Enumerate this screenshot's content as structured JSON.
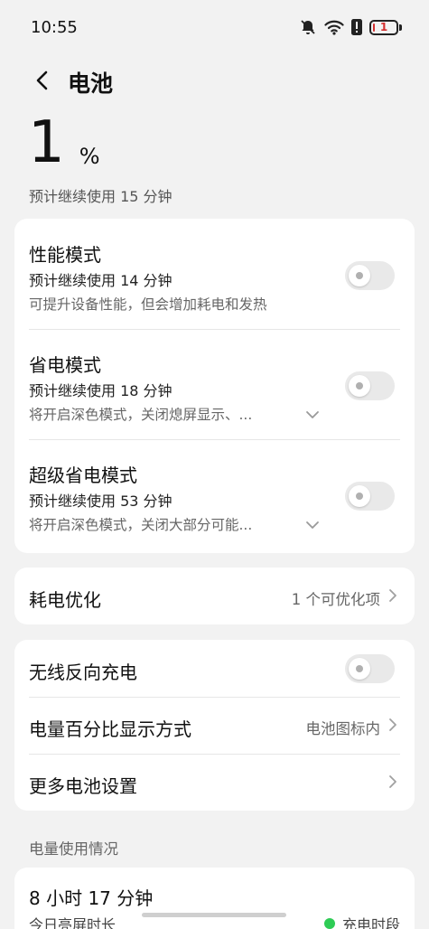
{
  "status_bar": {
    "time": "10:55",
    "battery_text": "1",
    "icons": [
      "bell-off-icon",
      "wifi-icon",
      "alert-icon",
      "battery-icon"
    ]
  },
  "header": {
    "title": "电池",
    "back_icon": "back-arrow-icon"
  },
  "battery": {
    "level": "1",
    "unit": "%",
    "estimate": "预计继续使用 15 分钟"
  },
  "modes": [
    {
      "title": "性能模式",
      "estimate": "预计继续使用 14 分钟",
      "desc": "可提升设备性能，但会增加耗电和发热",
      "enabled": false,
      "expandable": false
    },
    {
      "title": "省电模式",
      "estimate": "预计继续使用 18 分钟",
      "desc": "将开启深色模式，关闭熄屏显示、...",
      "enabled": false,
      "expandable": true
    },
    {
      "title": "超级省电模式",
      "estimate": "预计继续使用 53 分钟",
      "desc": "将开启深色模式，关闭大部分可能...",
      "enabled": false,
      "expandable": true
    }
  ],
  "optimization": {
    "label": "耗电优化",
    "value": "1 个可优化项"
  },
  "settings": {
    "reverse_charging_label": "无线反向充电",
    "reverse_charging_enabled": false,
    "percentage_label": "电量百分比显示方式",
    "percentage_value": "电池图标内",
    "more_label": "更多电池设置"
  },
  "usage": {
    "section_label": "电量使用情况",
    "screen_on_duration": "8 小时 17 分钟",
    "screen_on_label": "今日亮屏时长",
    "legend_label": "充电时段"
  },
  "colors": {
    "background": "#f2f2f2",
    "card": "#ffffff",
    "toggle_off": "#e9e9e9",
    "battery_low": "#d32f2f",
    "charging_legend": "#2ecc55"
  }
}
